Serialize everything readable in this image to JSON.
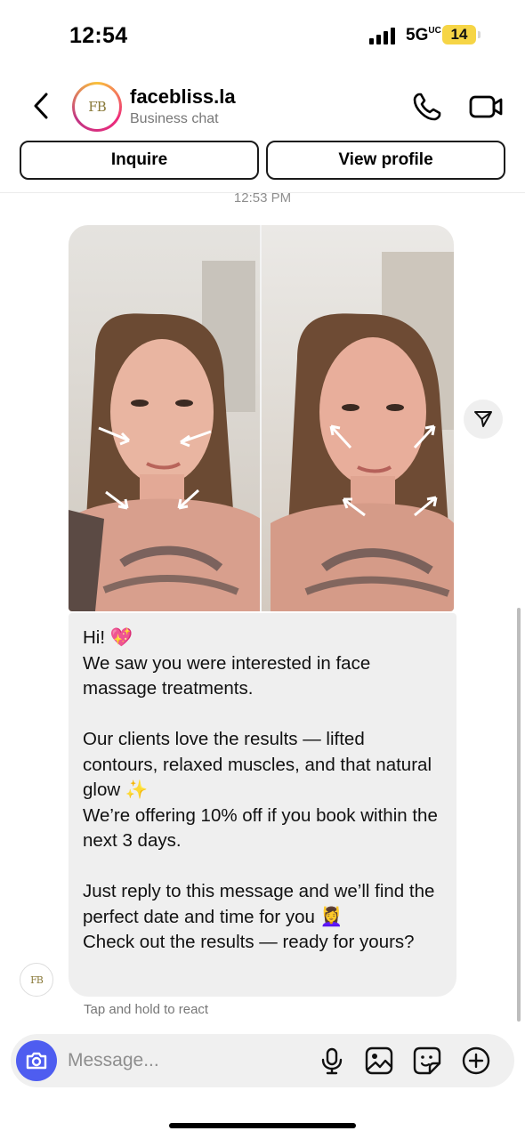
{
  "status_bar": {
    "time": "12:54",
    "network": "5G",
    "network_suffix": "UC",
    "battery": "14",
    "battery_color": "#f6d546"
  },
  "header": {
    "account_name": "facebliss.la",
    "subtitle": "Business chat",
    "avatar_logo": "FB",
    "avatar_logo_small": "face bliss",
    "icons": [
      "chevron-left-icon",
      "phone-icon",
      "video-camera-icon"
    ]
  },
  "actions": {
    "inquire": "Inquire",
    "view_profile": "View profile"
  },
  "thread": {
    "timestamp": "12:53 PM",
    "image": {
      "description_icons": [
        "share-icon"
      ]
    },
    "message": {
      "lines": [
        "Hi! 💖",
        "We saw you were interested in face massage treatments.",
        "",
        "Our clients love the results — lifted contours, relaxed muscles, and that natural glow ✨",
        "We’re offering 10% off if you book within the next 3 days.",
        "",
        "Just reply to this message and we’ll find the perfect date and time for you 💆‍♀️",
        "Check out the results — ready for yours?"
      ]
    },
    "hint": "Tap and hold to react"
  },
  "composer": {
    "placeholder": "Message...",
    "accent": "#4e5df0",
    "icons": [
      "camera-icon",
      "microphone-icon",
      "gallery-icon",
      "sticker-icon",
      "plus-icon"
    ]
  }
}
